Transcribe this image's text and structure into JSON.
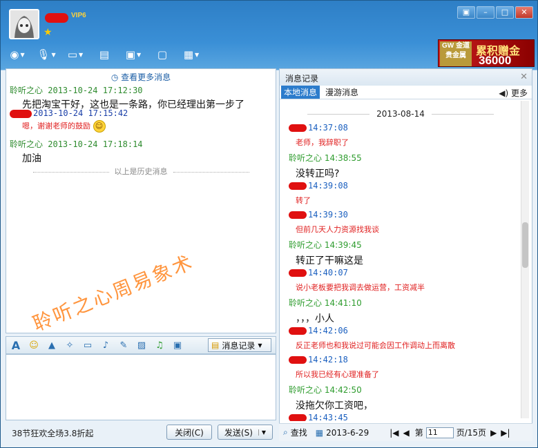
{
  "window": {
    "vip_label": "VIP6",
    "ad_logo": "GW 金道贵金属",
    "ad_line1": "累积赠金",
    "ad_line2": "36000",
    "minimize": "▣",
    "restore": "–",
    "maximize": "□",
    "close": "✕"
  },
  "chat": {
    "more_messages": "查看更多消息",
    "history_divider": "以上是历史消息",
    "messages": [
      {
        "sender": "聆听之心",
        "time": "2013-10-24  17:12:30",
        "text": "先把淘宝干好，这也是一条路，你已经理出第一步了"
      },
      {
        "sender": "",
        "time": "2013-10-24  17:15:42",
        "text": "嗯，谢谢老师的鼓励"
      },
      {
        "sender": "聆听之心",
        "time": "2013-10-24  17:18:14",
        "text": "加油"
      }
    ],
    "watermark": "聆听之心周易象术",
    "msg_record_btn": "消息记录",
    "promo": "38节狂欢全场3.8折起",
    "close_btn": "关闭(C)",
    "send_btn": "发送(S)"
  },
  "history": {
    "title": "消息记录",
    "tab_local": "本地消息",
    "tab_roam": "漫游消息",
    "more": "更多",
    "date": "2013-08-14",
    "rows": [
      {
        "who": "",
        "time": "14:37:08",
        "text": "老师，我辞职了",
        "style": "red"
      },
      {
        "who": "聆听之心",
        "time": "14:38:55",
        "text": "没转正吗?",
        "style": "black"
      },
      {
        "who": "",
        "time": "14:39:08",
        "text": "转了",
        "style": "red"
      },
      {
        "who": "",
        "time": "14:39:30",
        "text": "但前几天人力资源找我谈",
        "style": "red"
      },
      {
        "who": "聆听之心",
        "time": "14:39:45",
        "text": "转正了干嘛这是",
        "style": "black"
      },
      {
        "who": "",
        "time": "14:40:07",
        "text": "说小老板要把我调去做运营，工资减半",
        "style": "red"
      },
      {
        "who": "聆听之心",
        "time": "14:41:10",
        "text": "，，，小人",
        "style": "black"
      },
      {
        "who": "",
        "time": "14:42:06",
        "text": "反正老师也和我说过可能会因工作调动上而离散",
        "style": "red"
      },
      {
        "who": "",
        "time": "14:42:18",
        "text": "所以我已经有心理准备了",
        "style": "red"
      },
      {
        "who": "聆听之心",
        "time": "14:42:50",
        "text": "没拖欠你工资吧，",
        "style": "black"
      },
      {
        "who": "",
        "time": "14:43:45",
        "text": "",
        "style": "red"
      }
    ],
    "search": "查找",
    "date_filter": "2013-6-29",
    "page_prefix": "第",
    "page_value": "11",
    "page_suffix": "页/15页"
  }
}
